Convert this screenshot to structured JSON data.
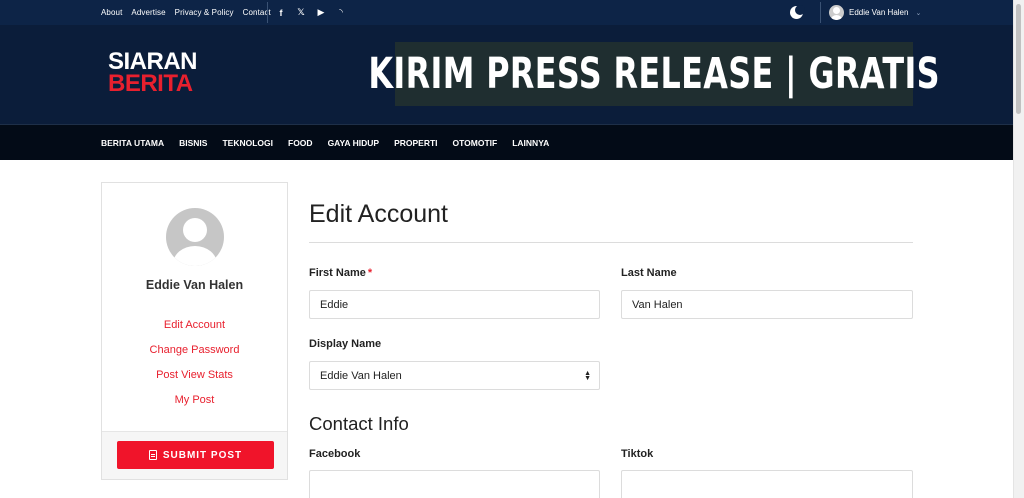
{
  "topbar": {
    "links": [
      "About",
      "Advertise",
      "Privacy & Policy",
      "Contact"
    ],
    "social_icons": [
      "facebook-icon",
      "x-icon",
      "youtube-icon",
      "rss-icon"
    ],
    "social_glyphs": [
      "f",
      "𝕏",
      "▶",
      "◝"
    ],
    "user_name": "Eddie Van Halen",
    "theme_toggle_icon": "moon-icon"
  },
  "header": {
    "logo_line1": "SIARAN",
    "logo_line2": "BERITA",
    "banner_text": "KIRIM PRESS RELEASE | GRATIS"
  },
  "nav": {
    "items": [
      "BERITA UTAMA",
      "BISNIS",
      "TEKNOLOGI",
      "FOOD",
      "GAYA HIDUP",
      "PROPERTI",
      "OTOMOTIF",
      "LAINNYA"
    ]
  },
  "sidebar": {
    "name": "Eddie Van Halen",
    "links": [
      "Edit Account",
      "Change Password",
      "Post View Stats",
      "My Post"
    ],
    "submit_label": "SUBMIT POST"
  },
  "form": {
    "title": "Edit Account",
    "first_name_label": "First Name",
    "required_mark": "*",
    "first_name_value": "Eddie",
    "last_name_label": "Last Name",
    "last_name_value": "Van Halen",
    "display_name_label": "Display Name",
    "display_name_value": "Eddie Van Halen",
    "contact_section": "Contact Info",
    "facebook_label": "Facebook",
    "facebook_value": "",
    "tiktok_label": "Tiktok",
    "tiktok_value": ""
  },
  "colors": {
    "topbar": "#0d2447",
    "header": "#0b1d3a",
    "nav": "#030b17",
    "accent": "#e8202e",
    "button": "#f0142a"
  }
}
